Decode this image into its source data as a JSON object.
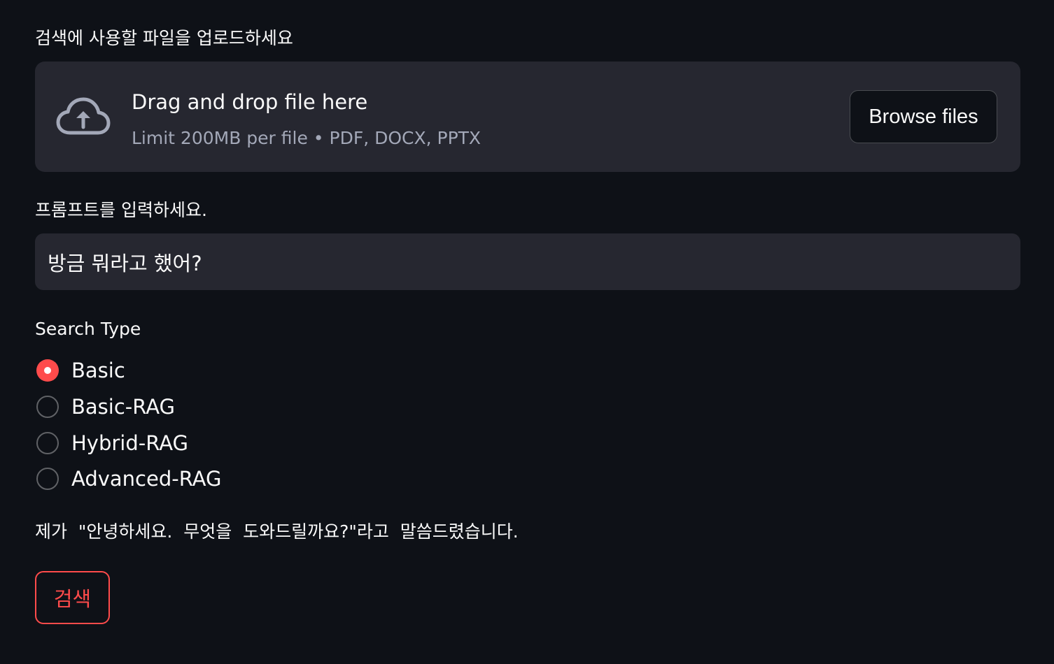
{
  "uploader": {
    "label": "검색에 사용할 파일을 업로드하세요",
    "drop_title": "Drag and drop file here",
    "drop_subtitle": "Limit 200MB per file • PDF, DOCX, PPTX",
    "browse_label": "Browse files",
    "icon": "cloud-upload-icon"
  },
  "prompt": {
    "label": "프롬프트를 입력하세요.",
    "value": "방금 뭐라고 했어?"
  },
  "search_type": {
    "label": "Search Type",
    "options": [
      {
        "label": "Basic",
        "selected": true
      },
      {
        "label": "Basic-RAG",
        "selected": false
      },
      {
        "label": "Hybrid-RAG",
        "selected": false
      },
      {
        "label": "Advanced-RAG",
        "selected": false
      }
    ]
  },
  "answer": {
    "text": "제가  \"안녕하세요.  무엇을  도와드릴까요?\"라고  말씀드렸습니다."
  },
  "search_button": {
    "label": "검색"
  },
  "colors": {
    "background": "#0e1117",
    "surface": "#262730",
    "accent": "#ff4b4b",
    "text": "#fafafa",
    "muted_text": "#a3a8b8"
  }
}
